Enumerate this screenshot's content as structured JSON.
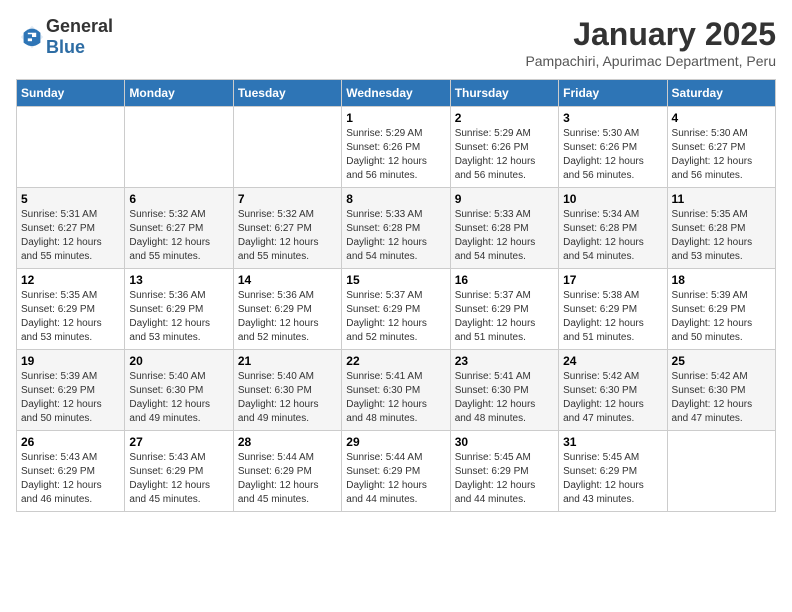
{
  "header": {
    "logo_general": "General",
    "logo_blue": "Blue",
    "title": "January 2025",
    "subtitle": "Pampachiri, Apurimac Department, Peru"
  },
  "days_of_week": [
    "Sunday",
    "Monday",
    "Tuesday",
    "Wednesday",
    "Thursday",
    "Friday",
    "Saturday"
  ],
  "weeks": [
    [
      {
        "day": "",
        "info": ""
      },
      {
        "day": "",
        "info": ""
      },
      {
        "day": "",
        "info": ""
      },
      {
        "day": "1",
        "info": "Sunrise: 5:29 AM\nSunset: 6:26 PM\nDaylight: 12 hours\nand 56 minutes."
      },
      {
        "day": "2",
        "info": "Sunrise: 5:29 AM\nSunset: 6:26 PM\nDaylight: 12 hours\nand 56 minutes."
      },
      {
        "day": "3",
        "info": "Sunrise: 5:30 AM\nSunset: 6:26 PM\nDaylight: 12 hours\nand 56 minutes."
      },
      {
        "day": "4",
        "info": "Sunrise: 5:30 AM\nSunset: 6:27 PM\nDaylight: 12 hours\nand 56 minutes."
      }
    ],
    [
      {
        "day": "5",
        "info": "Sunrise: 5:31 AM\nSunset: 6:27 PM\nDaylight: 12 hours\nand 55 minutes."
      },
      {
        "day": "6",
        "info": "Sunrise: 5:32 AM\nSunset: 6:27 PM\nDaylight: 12 hours\nand 55 minutes."
      },
      {
        "day": "7",
        "info": "Sunrise: 5:32 AM\nSunset: 6:27 PM\nDaylight: 12 hours\nand 55 minutes."
      },
      {
        "day": "8",
        "info": "Sunrise: 5:33 AM\nSunset: 6:28 PM\nDaylight: 12 hours\nand 54 minutes."
      },
      {
        "day": "9",
        "info": "Sunrise: 5:33 AM\nSunset: 6:28 PM\nDaylight: 12 hours\nand 54 minutes."
      },
      {
        "day": "10",
        "info": "Sunrise: 5:34 AM\nSunset: 6:28 PM\nDaylight: 12 hours\nand 54 minutes."
      },
      {
        "day": "11",
        "info": "Sunrise: 5:35 AM\nSunset: 6:28 PM\nDaylight: 12 hours\nand 53 minutes."
      }
    ],
    [
      {
        "day": "12",
        "info": "Sunrise: 5:35 AM\nSunset: 6:29 PM\nDaylight: 12 hours\nand 53 minutes."
      },
      {
        "day": "13",
        "info": "Sunrise: 5:36 AM\nSunset: 6:29 PM\nDaylight: 12 hours\nand 53 minutes."
      },
      {
        "day": "14",
        "info": "Sunrise: 5:36 AM\nSunset: 6:29 PM\nDaylight: 12 hours\nand 52 minutes."
      },
      {
        "day": "15",
        "info": "Sunrise: 5:37 AM\nSunset: 6:29 PM\nDaylight: 12 hours\nand 52 minutes."
      },
      {
        "day": "16",
        "info": "Sunrise: 5:37 AM\nSunset: 6:29 PM\nDaylight: 12 hours\nand 51 minutes."
      },
      {
        "day": "17",
        "info": "Sunrise: 5:38 AM\nSunset: 6:29 PM\nDaylight: 12 hours\nand 51 minutes."
      },
      {
        "day": "18",
        "info": "Sunrise: 5:39 AM\nSunset: 6:29 PM\nDaylight: 12 hours\nand 50 minutes."
      }
    ],
    [
      {
        "day": "19",
        "info": "Sunrise: 5:39 AM\nSunset: 6:29 PM\nDaylight: 12 hours\nand 50 minutes."
      },
      {
        "day": "20",
        "info": "Sunrise: 5:40 AM\nSunset: 6:30 PM\nDaylight: 12 hours\nand 49 minutes."
      },
      {
        "day": "21",
        "info": "Sunrise: 5:40 AM\nSunset: 6:30 PM\nDaylight: 12 hours\nand 49 minutes."
      },
      {
        "day": "22",
        "info": "Sunrise: 5:41 AM\nSunset: 6:30 PM\nDaylight: 12 hours\nand 48 minutes."
      },
      {
        "day": "23",
        "info": "Sunrise: 5:41 AM\nSunset: 6:30 PM\nDaylight: 12 hours\nand 48 minutes."
      },
      {
        "day": "24",
        "info": "Sunrise: 5:42 AM\nSunset: 6:30 PM\nDaylight: 12 hours\nand 47 minutes."
      },
      {
        "day": "25",
        "info": "Sunrise: 5:42 AM\nSunset: 6:30 PM\nDaylight: 12 hours\nand 47 minutes."
      }
    ],
    [
      {
        "day": "26",
        "info": "Sunrise: 5:43 AM\nSunset: 6:29 PM\nDaylight: 12 hours\nand 46 minutes."
      },
      {
        "day": "27",
        "info": "Sunrise: 5:43 AM\nSunset: 6:29 PM\nDaylight: 12 hours\nand 45 minutes."
      },
      {
        "day": "28",
        "info": "Sunrise: 5:44 AM\nSunset: 6:29 PM\nDaylight: 12 hours\nand 45 minutes."
      },
      {
        "day": "29",
        "info": "Sunrise: 5:44 AM\nSunset: 6:29 PM\nDaylight: 12 hours\nand 44 minutes."
      },
      {
        "day": "30",
        "info": "Sunrise: 5:45 AM\nSunset: 6:29 PM\nDaylight: 12 hours\nand 44 minutes."
      },
      {
        "day": "31",
        "info": "Sunrise: 5:45 AM\nSunset: 6:29 PM\nDaylight: 12 hours\nand 43 minutes."
      },
      {
        "day": "",
        "info": ""
      }
    ]
  ]
}
